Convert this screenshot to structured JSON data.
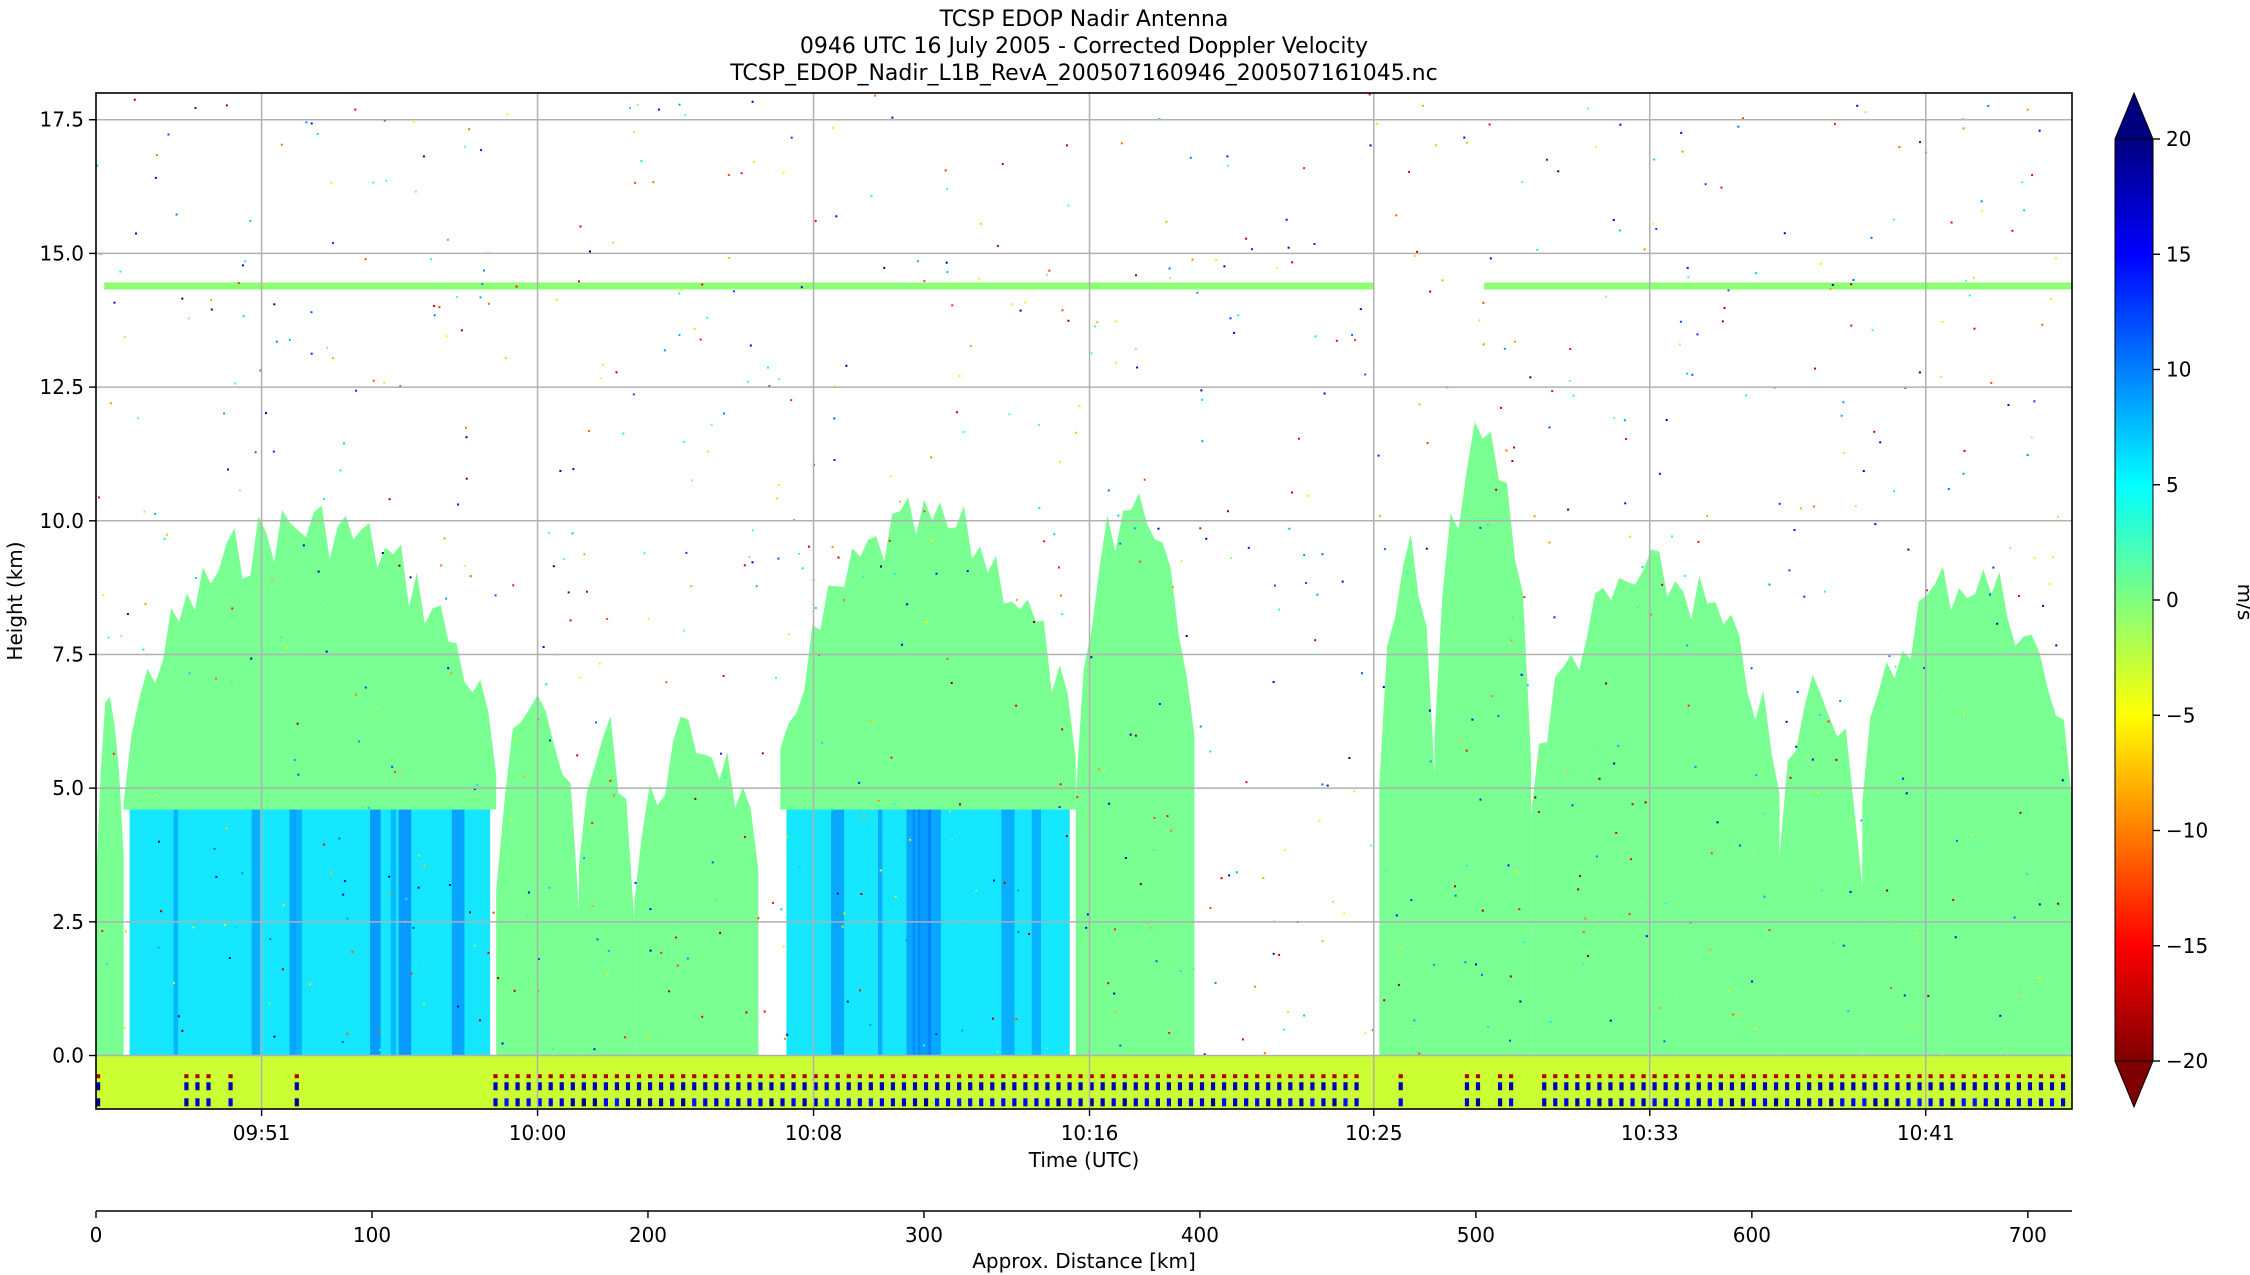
{
  "chart_data": {
    "type": "heatmap",
    "title_lines": [
      "TCSP EDOP Nadir Antenna",
      "0946 UTC 16 July 2005 - Corrected Doppler Velocity",
      "TCSP_EDOP_Nadir_L1B_RevA_200507160946_200507161045.nc"
    ],
    "xlabel": "Time (UTC)",
    "ylabel": "Height (km)",
    "x_tick_labels": [
      "09:51",
      "10:00",
      "10:08",
      "10:16",
      "10:25",
      "10:33",
      "10:41"
    ],
    "y_ticks": [
      0.0,
      2.5,
      5.0,
      7.5,
      10.0,
      12.5,
      15.0,
      17.5
    ],
    "y_tick_labels": [
      "0.0",
      "2.5",
      "5.0",
      "7.5",
      "10.0",
      "12.5",
      "15.0",
      "17.5"
    ],
    "ylim": [
      -1.0,
      18.0
    ],
    "grid": true,
    "distance_axis": {
      "label": "Approx. Distance [km]",
      "ticks": [
        0,
        100,
        200,
        300,
        400,
        500,
        600,
        700
      ],
      "tick_labels": [
        "0",
        "100",
        "200",
        "300",
        "400",
        "500",
        "600",
        "700"
      ],
      "xlim": [
        0,
        716
      ]
    },
    "colorbar": {
      "label": "m/s",
      "ticks": [
        20,
        15,
        10,
        5,
        0,
        -5,
        -10,
        -15,
        -20
      ],
      "tick_labels": [
        "20",
        "15",
        "10",
        "5",
        "0",
        "−5",
        "−10",
        "−15",
        "−20"
      ],
      "range": [
        -20,
        20
      ],
      "extend": "both",
      "colormap": "jet_r",
      "colors": [
        "#7f0000",
        "#ff0000",
        "#ff7f00",
        "#ffff00",
        "#7fff7f",
        "#00ffff",
        "#007fff",
        "#0000ff",
        "#00007f"
      ]
    },
    "features": {
      "tropopause_layer": {
        "height_km": 14.4,
        "velocity_ms": -0.5
      },
      "stratiform_ice_velocity_ms": 0.5,
      "rain_below_melting_velocity_ms": 6,
      "melting_level_km": 4.6,
      "surface_return_km": [
        -1.0,
        0.0
      ]
    },
    "precip_segments": [
      {
        "x_km": [
          0,
          10
        ],
        "top_km": 7.0,
        "rain": false
      },
      {
        "x_km": [
          10,
          145
        ],
        "top_km": 10.5,
        "rain": true
      },
      {
        "x_km": [
          145,
          175
        ],
        "top_km": 7.0,
        "rain": false
      },
      {
        "x_km": [
          175,
          195
        ],
        "top_km": 6.5,
        "rain": false
      },
      {
        "x_km": [
          195,
          240
        ],
        "top_km": 6.5,
        "rain": false
      },
      {
        "x_km": [
          248,
          355
        ],
        "top_km": 10.5,
        "rain": true
      },
      {
        "x_km": [
          355,
          398
        ],
        "top_km": 11.0,
        "rain": false
      },
      {
        "x_km": [
          465,
          485
        ],
        "top_km": 10.0,
        "rain": false
      },
      {
        "x_km": [
          485,
          520
        ],
        "top_km": 12.0,
        "rain": false
      },
      {
        "x_km": [
          520,
          610
        ],
        "top_km": 9.5,
        "rain": false
      },
      {
        "x_km": [
          610,
          640
        ],
        "top_km": 7.5,
        "rain": false
      },
      {
        "x_km": [
          640,
          716
        ],
        "top_km": 9.5,
        "rain": false
      }
    ]
  }
}
